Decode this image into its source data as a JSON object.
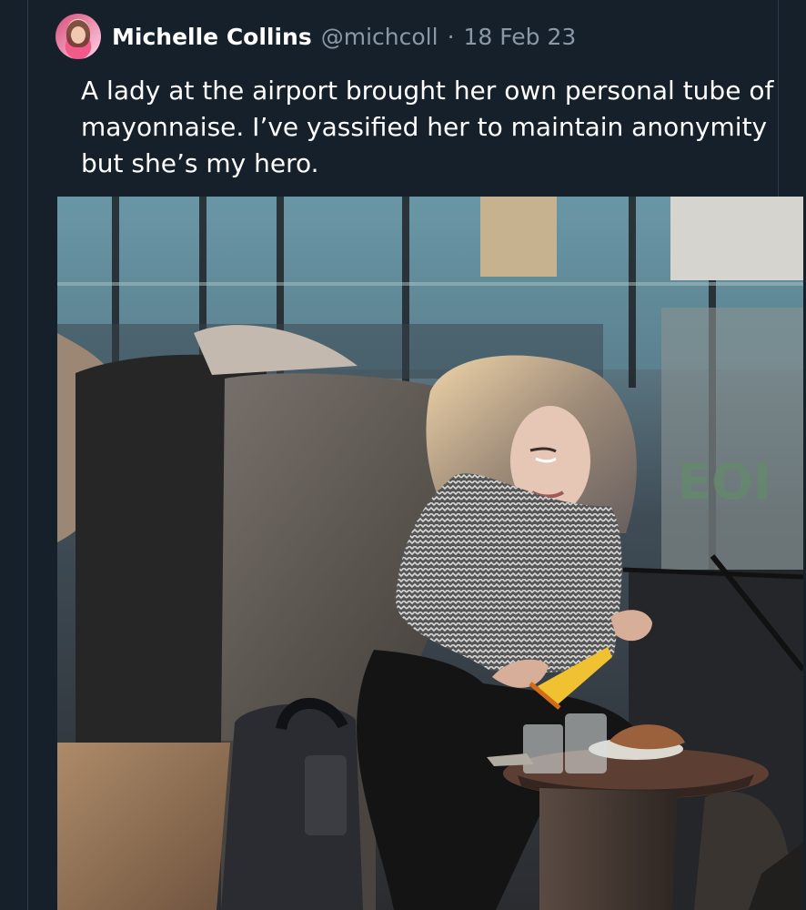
{
  "tweet": {
    "author": {
      "display_name": "Michelle Collins",
      "handle": "@michcoll",
      "separator": "·",
      "date": "18 Feb 23",
      "avatar_icon": "profile-avatar"
    },
    "text": "A lady at the airport brought her own personal tube of mayonnaise. I’ve yassified her to maintain anonymity but she’s my hero.",
    "media": {
      "type": "photo",
      "colors": {
        "background": "#15202b",
        "name": "#ffffff",
        "secondary_text": "#8b98a5",
        "tube": "#f0c231"
      }
    }
  }
}
